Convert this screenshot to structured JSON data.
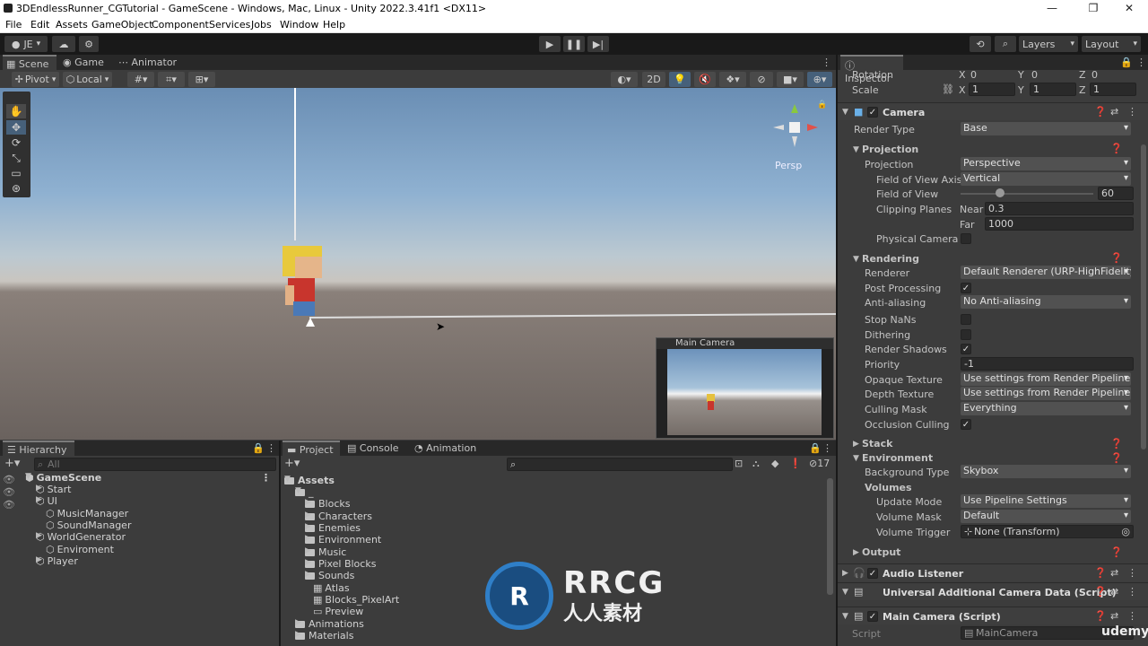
{
  "window": {
    "title": "3DEndlessRunner_CGTutorial - GameScene - Windows, Mac, Linux - Unity 2022.3.41f1 <DX11>",
    "minimize_icon": "minimize-icon",
    "maximize_icon": "maximize-icon",
    "close_icon": "close-icon"
  },
  "menu": [
    "File",
    "Edit",
    "Assets",
    "GameObject",
    "Component",
    "Services",
    "Jobs",
    "Window",
    "Help"
  ],
  "toolbar": {
    "account": "JE",
    "layers": "Layers",
    "layout": "Layout"
  },
  "scene": {
    "tabs": [
      "Scene",
      "Game",
      "Animator"
    ],
    "pivot": "Pivot",
    "local": "Local",
    "mode_2d": "2D",
    "persp": "Persp",
    "camera_preview_title": "Main Camera"
  },
  "inspector": {
    "tab": "Inspector",
    "transform": {
      "rotation_label": "Rotation",
      "rotation": {
        "x": "0",
        "y": "0",
        "z": "0"
      },
      "scale_label": "Scale",
      "scale": {
        "x": "1",
        "y": "1",
        "z": "1"
      },
      "x": "X",
      "y": "Y",
      "z": "Z"
    },
    "camera": {
      "title": "Camera",
      "render_type_label": "Render Type",
      "render_type": "Base",
      "projection_section": "Projection",
      "projection_label": "Projection",
      "projection": "Perspective",
      "fov_axis_label": "Field of View Axis",
      "fov_axis": "Vertical",
      "fov_label": "Field of View",
      "fov": "60",
      "fov_fraction": 0.3,
      "clipping_label": "Clipping Planes",
      "near_label": "Near",
      "near": "0.3",
      "far_label": "Far",
      "far": "1000",
      "physical_label": "Physical Camera",
      "rendering_section": "Rendering",
      "renderer_label": "Renderer",
      "renderer": "Default Renderer (URP-HighFidelity-",
      "post_label": "Post Processing",
      "aa_label": "Anti-aliasing",
      "aa": "No Anti-aliasing",
      "nan_label": "Stop NaNs",
      "dither_label": "Dithering",
      "shadows_label": "Render Shadows",
      "priority_label": "Priority",
      "priority": "-1",
      "opaque_label": "Opaque Texture",
      "opaque": "Use settings from Render Pipeline As",
      "depth_label": "Depth Texture",
      "depth": "Use settings from Render Pipeline As",
      "culling_label": "Culling Mask",
      "culling": "Everything",
      "occlusion_label": "Occlusion Culling",
      "stack_section": "Stack",
      "env_section": "Environment",
      "bg_label": "Background Type",
      "bg": "Skybox",
      "volumes_label": "Volumes",
      "update_label": "Update Mode",
      "update": "Use Pipeline Settings",
      "vmask_label": "Volume Mask",
      "vmask": "Default",
      "vtrigger_label": "Volume Trigger",
      "vtrigger": "None (Transform)",
      "output_section": "Output"
    },
    "audio_listener": "Audio Listener",
    "urp_data": "Universal Additional Camera Data (Script)",
    "main_camera_script": "Main Camera (Script)",
    "script_label": "Script",
    "script_value": "MainCamera"
  },
  "hierarchy": {
    "tab": "Hierarchy",
    "search_placeholder": "All",
    "scene": "GameScene",
    "items": [
      "Start",
      "UI",
      "MusicManager",
      "SoundManager",
      "WorldGenerator",
      "Enviroment",
      "Player"
    ]
  },
  "project": {
    "tabs": [
      "Project",
      "Console",
      "Animation"
    ],
    "hidden_count": "17",
    "root": "Assets",
    "underscore_folder": "_",
    "folders": [
      "Blocks",
      "Characters",
      "Enemies",
      "Environment",
      "Music",
      "Pixel Blocks",
      "Sounds"
    ],
    "files": [
      "Atlas",
      "Blocks_PixelArt",
      "Preview"
    ],
    "top_folders": [
      "Animations",
      "Materials"
    ]
  },
  "watermark": {
    "brand": "RRCG",
    "sub": "人人素材",
    "udemy": "udemy"
  }
}
